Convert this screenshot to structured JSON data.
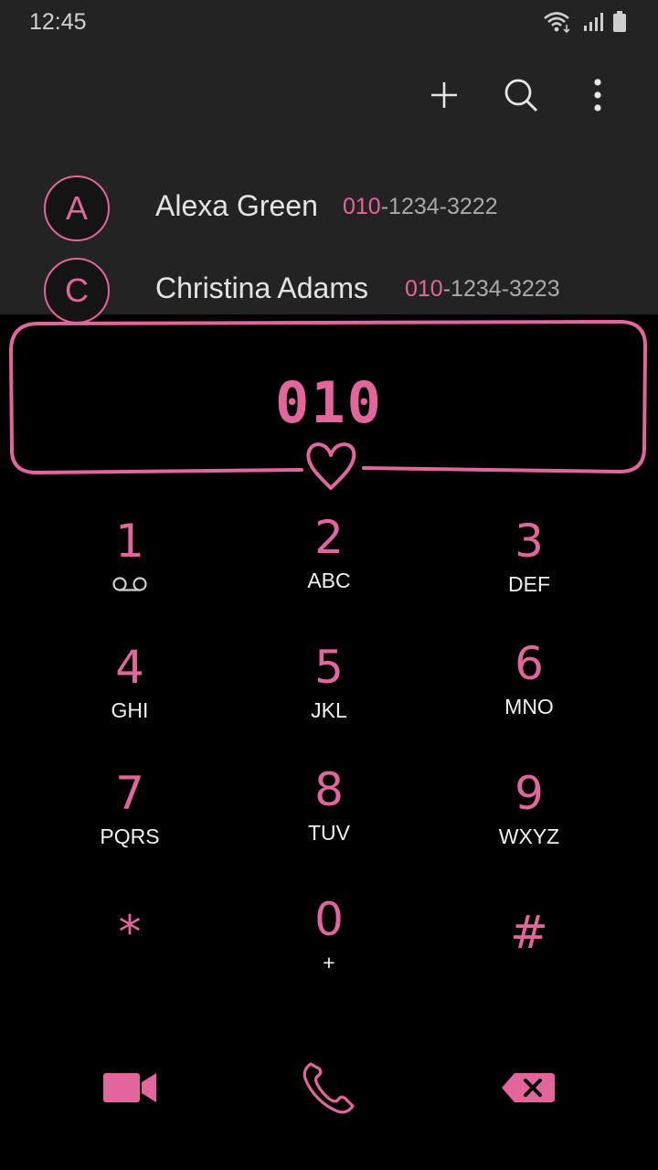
{
  "status": {
    "time": "12:45"
  },
  "contacts": [
    {
      "initial": "A",
      "name": "Alexa Green",
      "number_match": "010",
      "number_rest": "-1234-3222"
    },
    {
      "initial": "C",
      "name": "Christina Adams",
      "number_match": "010",
      "number_rest": "-1234-3223"
    }
  ],
  "dialer": {
    "number": "010"
  },
  "keys": [
    {
      "digit": "1",
      "letters": ""
    },
    {
      "digit": "2",
      "letters": "ABC"
    },
    {
      "digit": "3",
      "letters": "DEF"
    },
    {
      "digit": "4",
      "letters": "GHI"
    },
    {
      "digit": "5",
      "letters": "JKL"
    },
    {
      "digit": "6",
      "letters": "MNO"
    },
    {
      "digit": "7",
      "letters": "PQRS"
    },
    {
      "digit": "8",
      "letters": "TUV"
    },
    {
      "digit": "9",
      "letters": "WXYZ"
    },
    {
      "digit": "*",
      "letters": ""
    },
    {
      "digit": "0",
      "letters": "+"
    },
    {
      "digit": "#",
      "letters": ""
    }
  ],
  "icons": {
    "status": [
      "wifi-icon",
      "signal-icon",
      "battery-icon"
    ],
    "toolbar": [
      "add-icon",
      "search-icon",
      "more-icon"
    ],
    "actions": [
      "video-call-icon",
      "phone-icon",
      "backspace-icon"
    ],
    "voicemail": "voicemail-icon"
  },
  "colors": {
    "accent": "#e2669b",
    "top_bg": "#232323",
    "bg": "#000000",
    "text": "#e4e4e4"
  }
}
